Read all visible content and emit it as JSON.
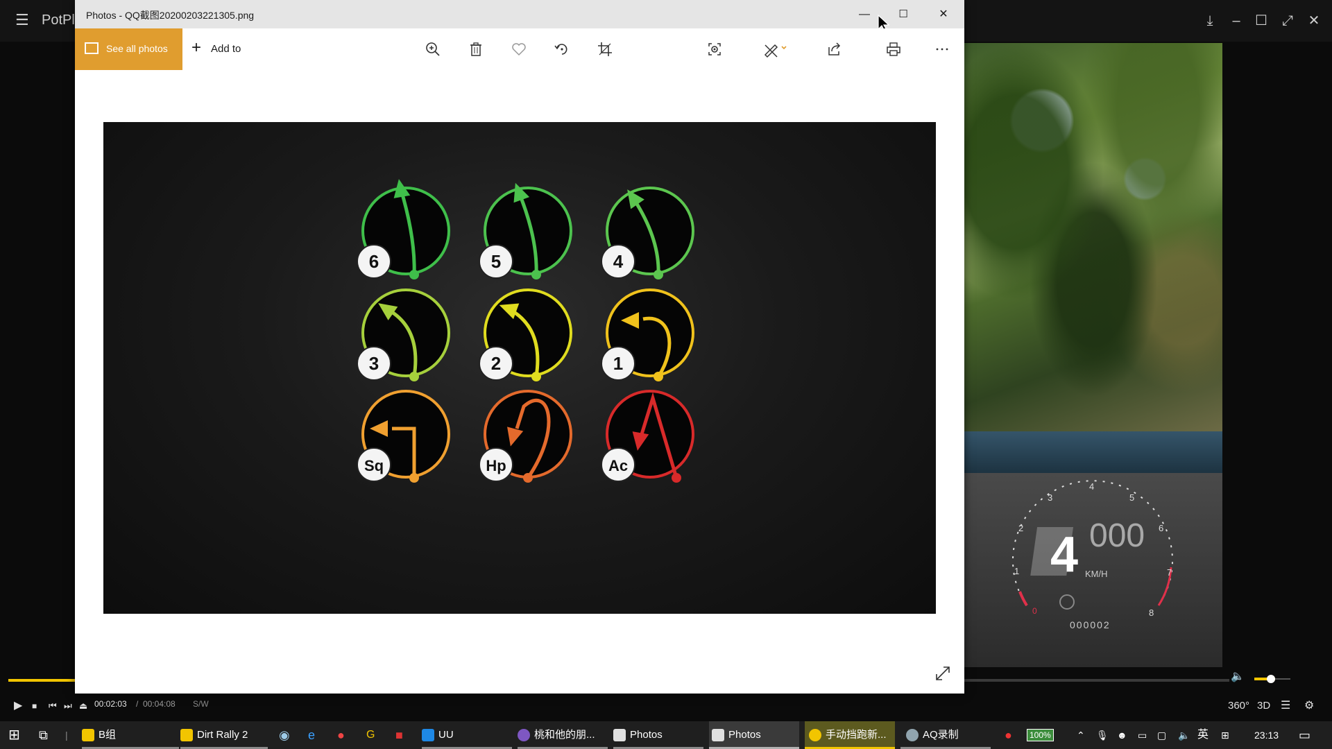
{
  "potplayer": {
    "logo": "PotPl",
    "time_current": "00:02:03",
    "time_separator": "/",
    "time_total": "00:04:08",
    "sw_label": "S/W",
    "btn_360": "360°",
    "btn_3d": "3D",
    "seek_progress": 0.06,
    "volume_level": 0.55
  },
  "video_hud": {
    "gear": "4",
    "speed": "000",
    "unit": "KM/H",
    "odometer": "000002",
    "rpm_ticks": [
      "0",
      "1",
      "2",
      "3",
      "4",
      "5",
      "6",
      "7",
      "8"
    ]
  },
  "photos": {
    "window_title": "Photos - QQ截图20200203221305.png",
    "see_all_label": "See all photos",
    "add_to_label": "Add to",
    "toolbar_icons": [
      "zoom-in-icon",
      "delete-icon",
      "heart-icon",
      "rotate-icon",
      "crop-icon",
      "enhance-icon",
      "edit-draw-icon",
      "share-icon",
      "print-icon",
      "more-icon"
    ]
  },
  "gear_indicators": [
    {
      "label": "6",
      "color": "#3fbf4a",
      "arrow": "straight"
    },
    {
      "label": "5",
      "color": "#4cc24e",
      "arrow": "straight"
    },
    {
      "label": "4",
      "color": "#5cc64f",
      "arrow": "straight"
    },
    {
      "label": "3",
      "color": "#a6d03c",
      "arrow": "curve"
    },
    {
      "label": "2",
      "color": "#e0dc1f",
      "arrow": "curve"
    },
    {
      "label": "1",
      "color": "#f0c21c",
      "arrow": "hook"
    },
    {
      "label": "Sq",
      "color": "#f0a030",
      "arrow": "square"
    },
    {
      "label": "Hp",
      "color": "#e46a2c",
      "arrow": "hairpin"
    },
    {
      "label": "Ac",
      "color": "#d82a2a",
      "arrow": "acute"
    }
  ],
  "taskbar": {
    "items": [
      {
        "label": "B组",
        "icon": "folder-icon",
        "color": "#f2c500"
      },
      {
        "label": "Dirt Rally 2",
        "icon": "folder-icon",
        "color": "#f2c500"
      },
      {
        "label": "UU",
        "icon": "uu-icon",
        "color": "#1e88e5"
      },
      {
        "label": "桃和他的朋...",
        "icon": "chat-icon",
        "color": "#7e57c2"
      },
      {
        "label": "Photos",
        "icon": "photos-icon",
        "color": "#e0e0e0"
      },
      {
        "label": "Photos",
        "icon": "photos-icon",
        "color": "#e0e0e0"
      },
      {
        "label": "手动挡跑新...",
        "icon": "potplayer-icon",
        "color": "#f2c500"
      },
      {
        "label": "AQ录制",
        "icon": "record-icon",
        "color": "#90a4ae"
      }
    ],
    "battery": "100%",
    "ime": "英",
    "clock": "23:13"
  }
}
